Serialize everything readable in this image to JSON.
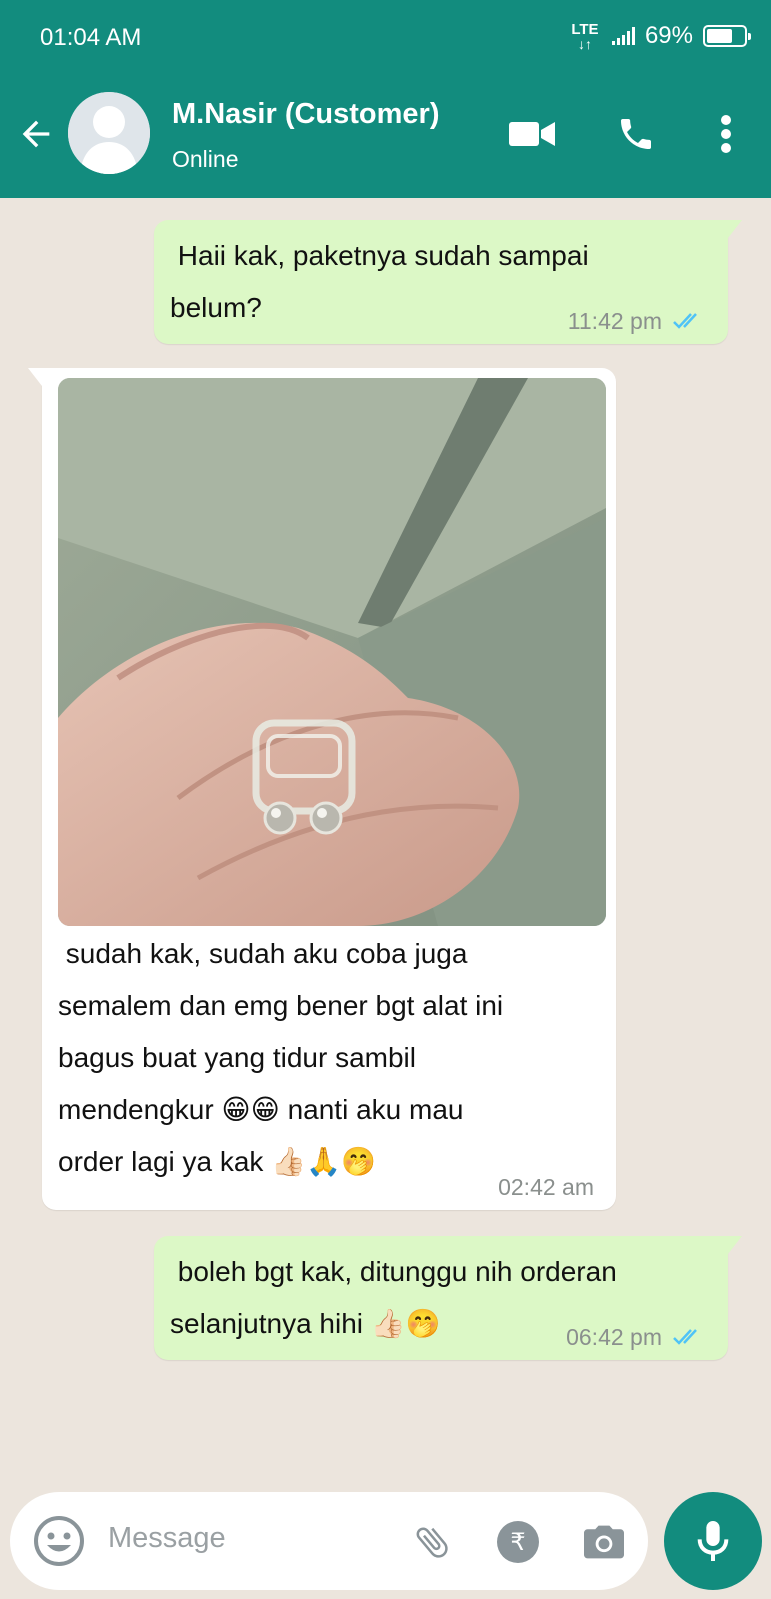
{
  "status_bar": {
    "time": "01:04 AM",
    "network": "LTE",
    "battery": "69%",
    "battery_level": 0.69
  },
  "header": {
    "contact_name": "M.Nasir (Customer)",
    "status": "Online",
    "icons": [
      "back-arrow-icon",
      "avatar",
      "video-call-icon",
      "phone-icon",
      "more-vert-icon"
    ]
  },
  "messages": [
    {
      "direction": "outgoing",
      "text": " Haii kak, paketnya sudah sampai\nbelum?",
      "time": "11:42 pm",
      "read": true
    },
    {
      "direction": "incoming",
      "has_photo": true,
      "text": " sudah kak, sudah aku coba juga\nsemalem dan emg bener bgt alat ini\nbagus buat yang tidur sambil\nmendengkur 😁😁 nanti aku mau\norder lagi ya kak 👍🏻🙏🤭",
      "time": "02:42 am"
    },
    {
      "direction": "outgoing",
      "text": " boleh bgt kak, ditunggu nih orderan\nselanjutnya hihi 👍🏻🤭",
      "time": "06:42 pm",
      "read": true
    }
  ],
  "input": {
    "placeholder": "Message",
    "icons": [
      "emoji-icon",
      "attach-icon",
      "rupee-payment-icon",
      "camera-icon",
      "mic-icon"
    ]
  },
  "colors": {
    "primary": "#128c7e",
    "outgoing_bubble": "#dcf8c6",
    "incoming_bubble": "#ffffff",
    "chat_background": "#ece5dd",
    "read_ticks": "#4fc3f7"
  }
}
